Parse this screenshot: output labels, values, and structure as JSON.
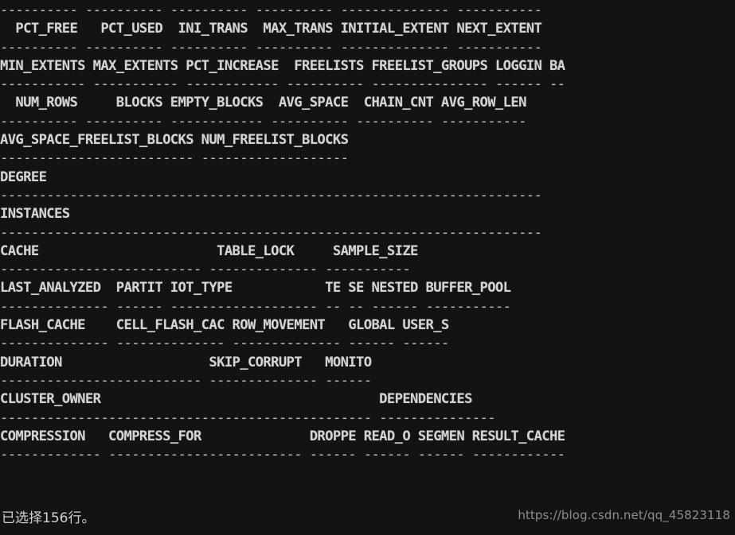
{
  "app": {
    "type": "terminal-console",
    "program": "SQL*Plus",
    "background_color": "#131313",
    "foreground_color": "#d4d4d4",
    "rule_color": "#b9b9b9",
    "watermark_color": "#8d8d8d"
  },
  "terminal": {
    "columns": 80,
    "rows": 24,
    "lines": [
      {
        "kind": "rule",
        "text": "---------- ---------- ---------- ---------- -------------- -----------"
      },
      {
        "kind": "header",
        "text": "  PCT_FREE   PCT_USED  INI_TRANS  MAX_TRANS INITIAL_EXTENT NEXT_EXTENT"
      },
      {
        "kind": "rule",
        "text": "---------- ---------- ---------- ---------- -------------- -----------"
      },
      {
        "kind": "header",
        "text": "MIN_EXTENTS MAX_EXTENTS PCT_INCREASE  FREELISTS FREELIST_GROUPS LOGGIN BA"
      },
      {
        "kind": "rule",
        "text": "----------- ----------- ------------ ---------- --------------- ------ --"
      },
      {
        "kind": "header",
        "text": "  NUM_ROWS     BLOCKS EMPTY_BLOCKS  AVG_SPACE  CHAIN_CNT AVG_ROW_LEN"
      },
      {
        "kind": "rule",
        "text": "---------- ---------- ------------ ---------- ---------- -----------"
      },
      {
        "kind": "header",
        "text": "AVG_SPACE_FREELIST_BLOCKS NUM_FREELIST_BLOCKS"
      },
      {
        "kind": "rule",
        "text": "------------------------- -------------------"
      },
      {
        "kind": "header",
        "text": "DEGREE"
      },
      {
        "kind": "rule",
        "text": "----------------------------------------------------------------------"
      },
      {
        "kind": "header",
        "text": "INSTANCES"
      },
      {
        "kind": "rule",
        "text": "----------------------------------------------------------------------"
      },
      {
        "kind": "header",
        "text": "CACHE                       TABLE_LOCK     SAMPLE_SIZE"
      },
      {
        "kind": "rule",
        "text": "-------------------------- -------------- -----------"
      },
      {
        "kind": "header",
        "text": "LAST_ANALYZED  PARTIT IOT_TYPE            TE SE NESTED BUFFER_POOL"
      },
      {
        "kind": "rule",
        "text": "-------------- ------ ------------------- -- -- ------ -----------"
      },
      {
        "kind": "header",
        "text": "FLASH_CACHE    CELL_FLASH_CAC ROW_MOVEMENT   GLOBAL USER_S"
      },
      {
        "kind": "rule",
        "text": "-------------- -------------- -------------- ------ ------"
      },
      {
        "kind": "header",
        "text": "DURATION                   SKIP_CORRUPT   MONITO"
      },
      {
        "kind": "rule",
        "text": "-------------------------- -------------- ------"
      },
      {
        "kind": "header",
        "text": "CLUSTER_OWNER                                    DEPENDENCIES"
      },
      {
        "kind": "rule",
        "text": "------------------------------------------------ ---------------"
      },
      {
        "kind": "header",
        "text": "COMPRESSION   COMPRESS_FOR              DROPPE READ_O SEGMEN RESULT_CACHE"
      },
      {
        "kind": "rule",
        "text": "------------- ------------------------- ------ ------ ------ ------------"
      }
    ]
  },
  "status": {
    "prefix": "已选择",
    "row_count": "156",
    "suffix": "行。",
    "full_text": "已选择156行。"
  },
  "watermark": {
    "url": "https://blog.csdn.net/qq_45823118"
  }
}
